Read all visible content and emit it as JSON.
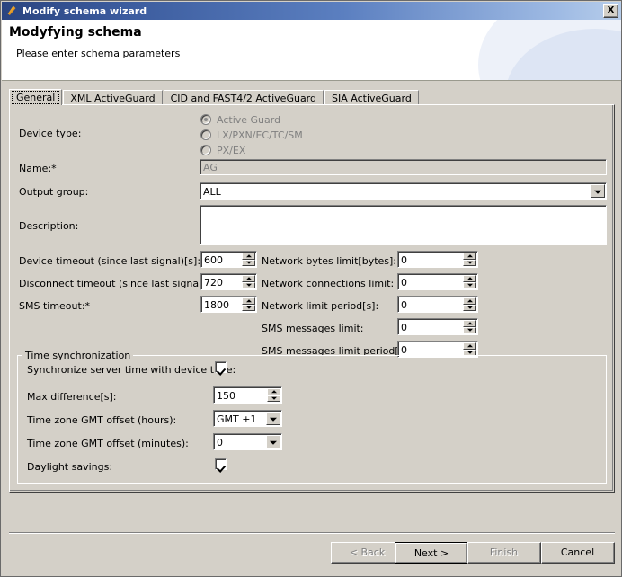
{
  "window": {
    "title": "Modify schema wizard",
    "icon": "pencil-icon",
    "close_label": "X"
  },
  "header": {
    "title": "Modyfying schema",
    "subtitle": "Please enter schema parameters"
  },
  "tabs": [
    {
      "label": "General",
      "active": true
    },
    {
      "label": "XML ActiveGuard",
      "active": false
    },
    {
      "label": "CID and FAST4/2 ActiveGuard",
      "active": false
    },
    {
      "label": "SIA ActiveGuard",
      "active": false
    }
  ],
  "form": {
    "device_type_label": "Device type:",
    "device_type_options": [
      {
        "label": "Active Guard",
        "selected": true,
        "disabled": true
      },
      {
        "label": "LX/PXN/EC/TC/SM",
        "selected": false,
        "disabled": true
      },
      {
        "label": "PX/EX",
        "selected": false,
        "disabled": true
      }
    ],
    "name_label": "Name:*",
    "name_value": "AG",
    "output_group_label": "Output group:",
    "output_group_value": "ALL",
    "description_label": "Description:",
    "description_value": "",
    "device_timeout_label": "Device timeout (since last signal)[s]:*",
    "device_timeout_value": "600",
    "disconnect_timeout_label": "Disconnect timeout (since last signal)[s]:*",
    "disconnect_timeout_value": "720",
    "sms_timeout_label": "SMS timeout:*",
    "sms_timeout_value": "1800",
    "network_bytes_limit_label": "Network bytes limit[bytes]:",
    "network_bytes_limit_value": "0",
    "network_connections_limit_label": "Network connections limit:",
    "network_connections_limit_value": "0",
    "network_limit_period_label": "Network limit period[s]:",
    "network_limit_period_value": "0",
    "sms_messages_limit_label": "SMS messages limit:",
    "sms_messages_limit_value": "0",
    "sms_messages_limit_period_label": "SMS messages limit period[s]:",
    "sms_messages_limit_period_value": "0"
  },
  "time_sync": {
    "group_title": "Time synchronization",
    "sync_label": "Synchronize server time with device time:",
    "sync_checked": true,
    "max_difference_label": "Max difference[s]:",
    "max_difference_value": "150",
    "gmt_hours_label": "Time zone GMT offset (hours):",
    "gmt_hours_value": "GMT +1",
    "gmt_minutes_label": "Time zone GMT offset (minutes):",
    "gmt_minutes_value": "0",
    "daylight_label": "Daylight savings:",
    "daylight_checked": true
  },
  "footer": {
    "back_label": "< Back",
    "next_label": "Next >",
    "finish_label": "Finish",
    "cancel_label": "Cancel"
  }
}
